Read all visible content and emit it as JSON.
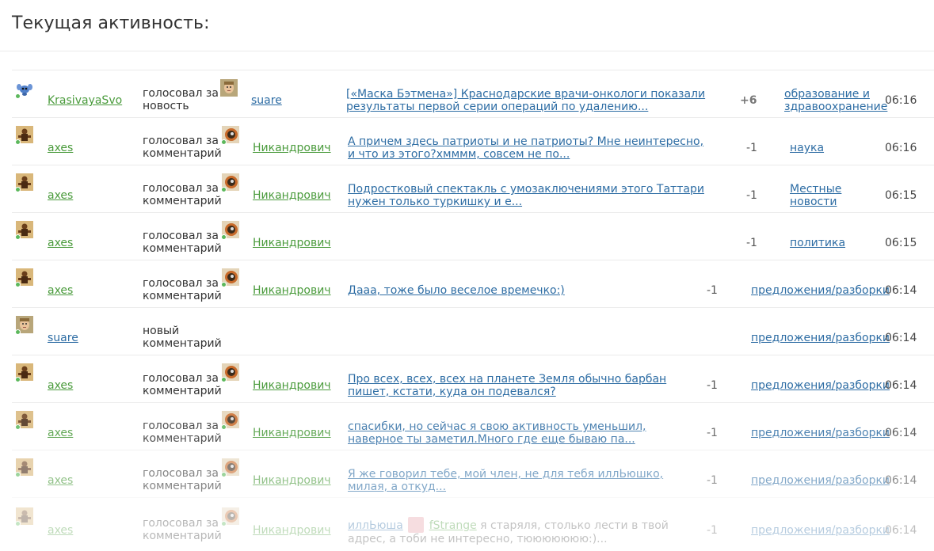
{
  "page": {
    "title": "Текущая активность:"
  },
  "colors": {
    "user_link": "#4a9b3c",
    "content_link": "#2e6da4",
    "online": "#5cb85c",
    "divider": "#ebebeb"
  },
  "rows": [
    {
      "actor": "KrasivayaSvo",
      "actor_icon": "stitch-avatar-icon",
      "action": "голосовал за новость",
      "target": "suare",
      "target_icon": "face-avatar-icon",
      "content": "[«Маска Бэтмена»] Краснодарские врачи-онкологи показали результаты первой серии операций по удалению...",
      "score": "+6",
      "category": "образование и здравоохранение",
      "time": "06:16"
    },
    {
      "actor": "axes",
      "actor_icon": "figure-avatar-icon",
      "action": "голосовал за комментарий",
      "target": "Никандрович",
      "target_icon": "eye-avatar-icon",
      "content": "А причем здесь патриоты и не патриоты? Мне неинтересно, и что из этого?хмммм, совсем не по...",
      "score": "-1",
      "category": "наука",
      "time": "06:16"
    },
    {
      "actor": "axes",
      "actor_icon": "figure-avatar-icon",
      "action": "голосовал за комментарий",
      "target": "Никандрович",
      "target_icon": "eye-avatar-icon",
      "content": "Подростковый спектакль с умозаключениями этого Таттари нужен только туркишку и е...",
      "score": "-1",
      "category": "Местные новости",
      "time": "06:15"
    },
    {
      "actor": "axes",
      "actor_icon": "figure-avatar-icon",
      "action": "голосовал за комментарий",
      "target": "Никандрович",
      "target_icon": "eye-avatar-icon",
      "content": "",
      "score": "-1",
      "category": "политика",
      "time": "06:15"
    },
    {
      "actor": "axes",
      "actor_icon": "figure-avatar-icon",
      "action": "голосовал за комментарий",
      "target": "Никандрович",
      "target_icon": "eye-avatar-icon",
      "content": "Дааа, тоже было веселое времечко:)",
      "score": "-1",
      "category": "предложения/разборки",
      "time": "06:14"
    },
    {
      "actor": "suare",
      "actor_icon": "face-avatar-icon",
      "action": "новый комментарий",
      "target": "",
      "target_icon": "",
      "content": "",
      "score": "",
      "category": "предложения/разборки",
      "time": "06:14"
    },
    {
      "actor": "axes",
      "actor_icon": "figure-avatar-icon",
      "action": "голосовал за комментарий",
      "target": "Никандрович",
      "target_icon": "eye-avatar-icon",
      "content": "Про всех, всех, всех на планете Земля обычно барбан пишет, кстати, куда он подевался?",
      "score": "-1",
      "category": "предложения/разборки",
      "time": "06:14"
    },
    {
      "actor": "axes",
      "actor_icon": "figure-avatar-icon",
      "action": "голосовал за комментарий",
      "target": "Никандрович",
      "target_icon": "eye-avatar-icon",
      "content": "спасибки, но сейчас я свою активность уменьшил, наверное ты заметил.Много где еще бываю па...",
      "score": "-1",
      "category": "предложения/разборки",
      "time": "06:14"
    },
    {
      "actor": "axes",
      "actor_icon": "figure-avatar-icon",
      "action": "голосовал за комментарий",
      "target": "Никандрович",
      "target_icon": "eye-avatar-icon",
      "content": "Я же говорил тебе, мой член, не для тебя иллЬюшко, милая, а откуд...",
      "score": "-1",
      "category": "предложения/разборки",
      "time": "06:14"
    },
    {
      "actor": "axes",
      "actor_icon": "figure-avatar-icon",
      "action": "голосовал за комментарий",
      "target": "Никандрович",
      "target_icon": "eye-avatar-icon",
      "content_prefix": "иллЬюша",
      "content_mention": "fStrange",
      "content_rest": "я старяля, столько лести в твой адрес, а тоби не интересно, тююююююю:)...",
      "score": "-1",
      "category": "предложения/разборки",
      "time": "06:14"
    }
  ]
}
